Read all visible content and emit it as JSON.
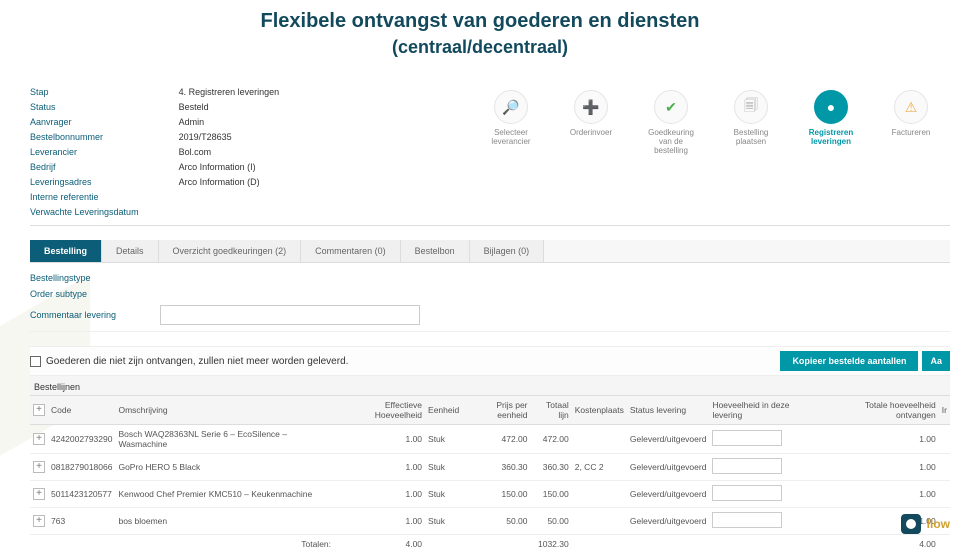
{
  "title": "Flexibele ontvangst van goederen en diensten",
  "subtitle": "(centraal/decentraal)",
  "info_labels": {
    "stap": "Stap",
    "status": "Status",
    "aanvrager": "Aanvrager",
    "bestelbonnummer": "Bestelbonnummer",
    "leverancier": "Leverancier",
    "bedrijf": "Bedrijf",
    "leveringsadres": "Leveringsadres",
    "interne_referentie": "Interne referentie",
    "verwachte": "Verwachte Leveringsdatum"
  },
  "info_values": {
    "stap": "4. Registreren leveringen",
    "status": "Besteld",
    "aanvrager": "Admin",
    "bestelbonnummer": "2019/T28635",
    "leverancier": "Bol.com",
    "bedrijf": "Arco Information (I)",
    "leveringsadres": "Arco Information (D)"
  },
  "steps": [
    {
      "icon": "🔎",
      "label": "Selecteer leverancier"
    },
    {
      "icon": "➕",
      "label": "Orderinvoer",
      "green": true
    },
    {
      "icon": "✔",
      "label": "Goedkeuring van de bestelling",
      "green": true
    },
    {
      "icon": "🗐",
      "label": "Bestelling plaatsen"
    },
    {
      "icon": "●",
      "label": "Registreren leveringen",
      "active": true
    },
    {
      "icon": "⚠",
      "label": "Factureren",
      "warn": true
    }
  ],
  "tabs": [
    {
      "label": "Bestelling",
      "active": true
    },
    {
      "label": "Details"
    },
    {
      "label": "Overzicht goedkeuringen (2)"
    },
    {
      "label": "Commentaren (0)"
    },
    {
      "label": "Bestelbon"
    },
    {
      "label": "Bijlagen (0)"
    }
  ],
  "fields": {
    "bestellingstype": "Bestellingstype",
    "order_subtype": "Order subtype",
    "commentaar": "Commentaar levering"
  },
  "checkbox_label": "Goederen die niet zijn ontvangen, zullen niet meer worden geleverd.",
  "btn_kopieer": "Kopieer bestelde aantallen",
  "btn_aa": "Aa",
  "grid_title": "Bestellijnen",
  "headers": {
    "code": "Code",
    "omschrijving": "Omschrijving",
    "eff": "Effectieve Hoeveelheid",
    "eenheid": "Eenheid",
    "prijs": "Prijs per eenheid",
    "totaal": "Totaal lijn",
    "kosten": "Kostenplaats",
    "status": "Status levering",
    "hoev": "Hoeveelheid in deze levering",
    "totontv": "Totale hoeveelheid ontvangen",
    "ir": "Ir"
  },
  "rows": [
    {
      "code": "4242002793290",
      "oms": "Bosch WAQ28363NL Serie 6 – EcoSilence – Wasmachine",
      "eff": "1.00",
      "een": "Stuk",
      "prijs": "472.00",
      "tot": "472.00",
      "kp": "",
      "st": "Geleverd/uitgevoerd",
      "ontv": "1.00"
    },
    {
      "code": "0818279018066",
      "oms": "GoPro HERO 5 Black",
      "eff": "1.00",
      "een": "Stuk",
      "prijs": "360.30",
      "tot": "360.30",
      "kp": "2, CC 2",
      "st": "Geleverd/uitgevoerd",
      "ontv": "1.00"
    },
    {
      "code": "5011423120577",
      "oms": "Kenwood Chef Premier KMC510 – Keukenmachine",
      "eff": "1.00",
      "een": "Stuk",
      "prijs": "150.00",
      "tot": "150.00",
      "kp": "",
      "st": "Geleverd/uitgevoerd",
      "ontv": "1.00"
    },
    {
      "code": "763",
      "oms": "bos bloemen",
      "eff": "1.00",
      "een": "Stuk",
      "prijs": "50.00",
      "tot": "50.00",
      "kp": "",
      "st": "Geleverd/uitgevoerd",
      "ontv": "1.00"
    }
  ],
  "totals": {
    "label": "Totalen:",
    "eff": "4.00",
    "tot": "1032.30",
    "ontv": "4.00"
  },
  "brand": "llow"
}
